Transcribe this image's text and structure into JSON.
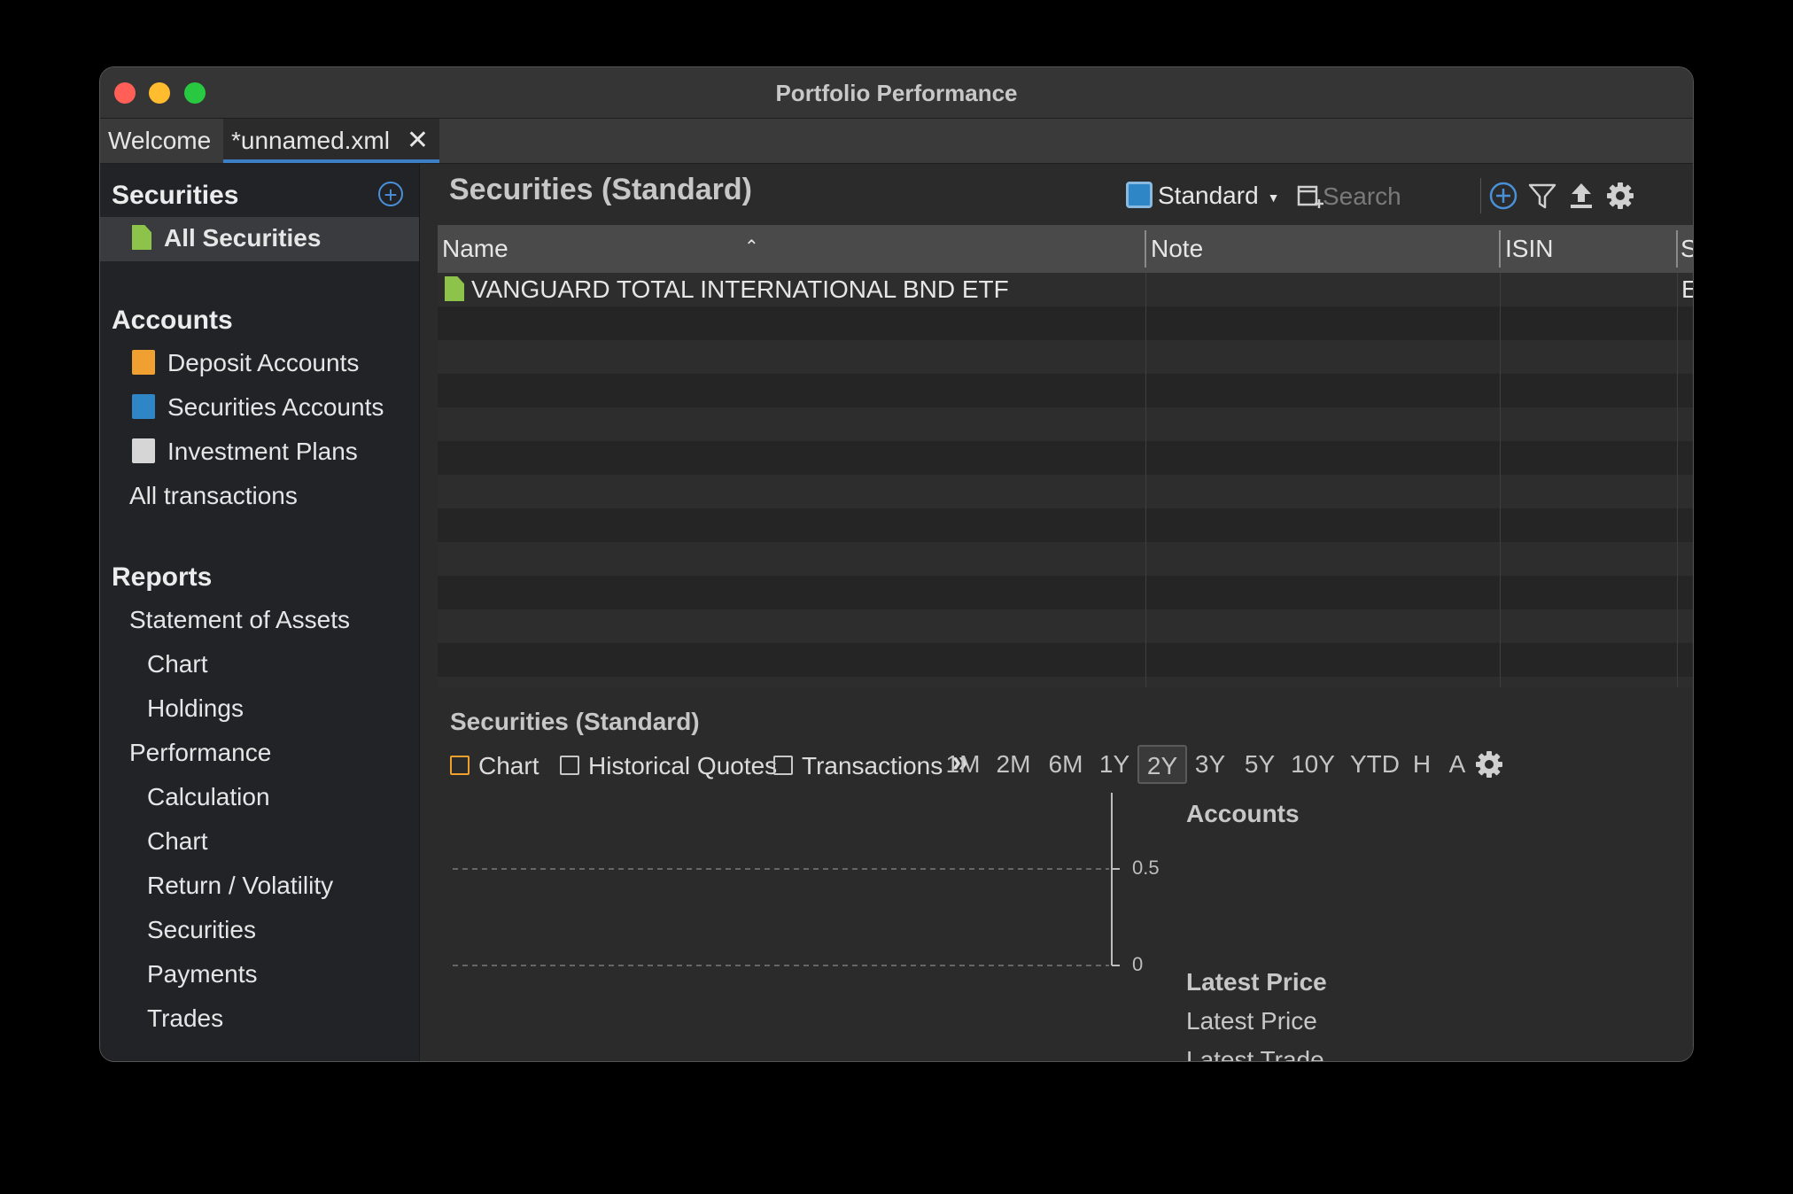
{
  "window": {
    "title": "Portfolio Performance"
  },
  "tabs": [
    {
      "label": "Welcome"
    },
    {
      "label": "*unnamed.xml"
    }
  ],
  "sidebar": {
    "securities_header": "Securities",
    "all_securities": "All Securities",
    "accounts_header": "Accounts",
    "deposit_accounts": "Deposit Accounts",
    "securities_accounts": "Securities Accounts",
    "investment_plans": "Investment Plans",
    "all_transactions": "All transactions",
    "reports_header": "Reports",
    "reports": [
      {
        "label": "Statement of Assets"
      },
      {
        "label": "Chart"
      },
      {
        "label": "Holdings"
      },
      {
        "label": "Performance"
      },
      {
        "label": "Calculation"
      },
      {
        "label": "Chart"
      },
      {
        "label": "Return / Volatility"
      },
      {
        "label": "Securities"
      },
      {
        "label": "Payments"
      },
      {
        "label": "Trades"
      }
    ],
    "colors": {
      "deposit": "#f0a030",
      "securities": "#2f86c6",
      "plans": "#d6d6d6",
      "doc": "#8dc34a"
    }
  },
  "main": {
    "title": "Securities (Standard)",
    "view_selector": "Standard",
    "search_placeholder": "Search",
    "columns": [
      "Name",
      "Note",
      "ISIN",
      "S"
    ],
    "rows": [
      {
        "name": "VANGUARD TOTAL INTERNATIONAL BND ETF",
        "note": "",
        "isin": "",
        "extra": "E"
      }
    ]
  },
  "bottom": {
    "title": "Securities (Standard)",
    "tabs": [
      "Chart",
      "Historical Quotes",
      "Transactions"
    ],
    "more": "»",
    "periods": [
      "1M",
      "2M",
      "6M",
      "1Y",
      "2Y",
      "3Y",
      "5Y",
      "10Y",
      "YTD",
      "H",
      "A"
    ],
    "selected_period": "2Y",
    "y_ticks": [
      "0.5",
      "0"
    ],
    "legend": {
      "accounts": "Accounts",
      "latest_price_header": "Latest Price",
      "latest_price_item": "Latest Price",
      "latest_trade_item": "Latest Trade"
    }
  }
}
